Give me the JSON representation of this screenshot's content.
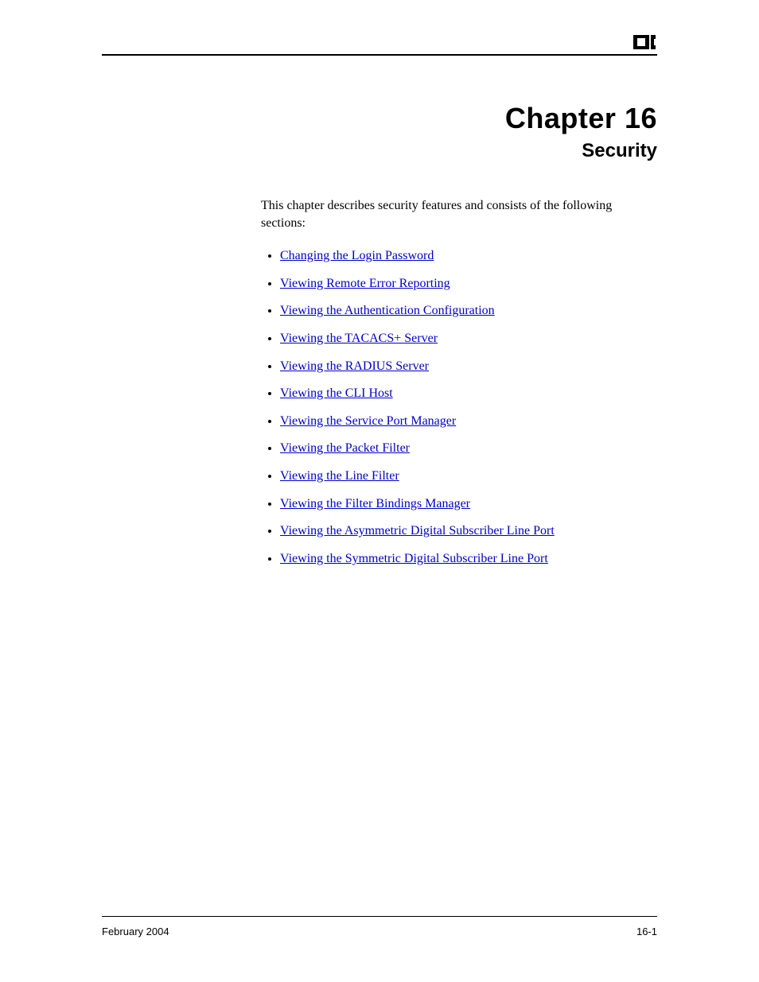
{
  "header": {
    "chapter_number": "Chapter 16",
    "chapter_title": "Security"
  },
  "intro": "This chapter describes security features and consists of the following sections:",
  "links": [
    "Changing the Login Password",
    "Viewing Remote Error Reporting",
    "Viewing the Authentication Configuration",
    "Viewing the TACACS+ Server",
    "Viewing the RADIUS Server",
    "Viewing the CLI Host",
    "Viewing the Service Port Manager",
    "Viewing the Packet Filter",
    "Viewing the Line Filter",
    "Viewing the Filter Bindings Manager",
    "Viewing the Asymmetric Digital Subscriber Line Port",
    "Viewing the Symmetric Digital Subscriber Line Port"
  ],
  "footer": {
    "left": "February 2004",
    "right": "16-1"
  }
}
